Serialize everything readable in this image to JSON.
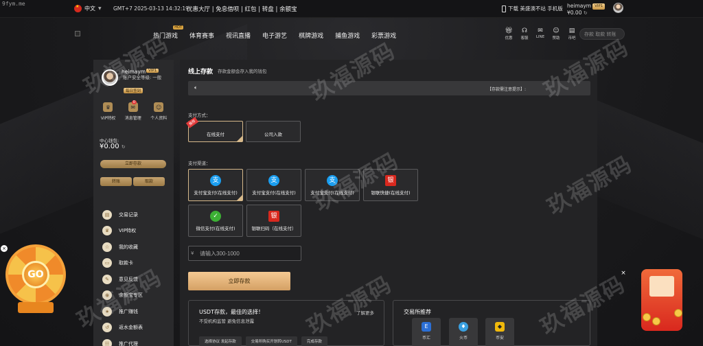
{
  "topbar": {
    "site_tag": "9fym.me",
    "language": "中文",
    "clock": "GMT+7 2025-03-13 14:32:19",
    "quick_links": "优惠大厅 | 免息借呗 | 红包 | 转盘 | 余额宝",
    "download": "下载 美盛澳不站 手机版",
    "username": "heimaym",
    "vip_tag": "VIP1",
    "balance": "¥0.00"
  },
  "nav": {
    "items": [
      {
        "label": "热门游戏",
        "badge": "HOT"
      },
      {
        "label": "体育赛事"
      },
      {
        "label": "视讯直播"
      },
      {
        "label": "电子游艺"
      },
      {
        "label": "棋牌游戏"
      },
      {
        "label": "捕鱼游戏"
      },
      {
        "label": "彩票游戏"
      }
    ],
    "icons": [
      {
        "label": "优惠",
        "icon": "gift-icon"
      },
      {
        "label": "客服",
        "icon": "headset-icon"
      },
      {
        "label": "LINE",
        "icon": "chat-icon"
      },
      {
        "label": "赞助",
        "icon": "people-icon"
      },
      {
        "label": "币吧",
        "icon": "wallet-icon"
      }
    ],
    "search_placeholder": "存款 取款 转账"
  },
  "sidebar": {
    "username": "heimaym",
    "vip": "VIP1",
    "security": "账户安全等级: 一般",
    "sign": "每日签到",
    "quick": [
      {
        "label": "VIP特权",
        "icon": "crown-icon"
      },
      {
        "label": "消息管理",
        "icon": "message-icon",
        "badge": "0"
      },
      {
        "label": "个人资料",
        "icon": "profile-icon"
      }
    ],
    "wallet_label": "中心钱包:",
    "wallet_value": "¥0.00",
    "btn_main": "立即存款",
    "btn_transfer": "转账",
    "btn_withdraw": "取款",
    "menu": [
      {
        "label": "交易记录",
        "icon": "record-icon"
      },
      {
        "label": "VIP特权",
        "icon": "crown-icon"
      },
      {
        "label": "我的收藏",
        "icon": "star-icon"
      },
      {
        "label": "取款卡",
        "icon": "card-icon"
      },
      {
        "label": "意见反馈",
        "icon": "feedback-icon"
      },
      {
        "label": "余额宝专区",
        "icon": "piggy-icon"
      },
      {
        "label": "推广赚钱",
        "icon": "promo-icon"
      },
      {
        "label": "返水金额表",
        "icon": "rebate-icon"
      },
      {
        "label": "推广代理",
        "icon": "agent-icon"
      }
    ]
  },
  "main": {
    "title": "线上存款",
    "subtitle": "存款金额会存入我的钱包",
    "notice": "【存款需注意提示】:",
    "pay_method_label": "支付方式：",
    "pay_methods": [
      {
        "label": "在线支付",
        "ribbon": "推荐",
        "selected": true
      },
      {
        "label": "公司入款",
        "selected": false
      }
    ],
    "channel_label": "支付渠道：",
    "channels": [
      {
        "label": "支付宝支付(在线支付)",
        "icon": "alipay-icon",
        "color": "#1a9ef0",
        "selected": true
      },
      {
        "label": "支付宝支付(在线支付)",
        "icon": "alipay-icon",
        "color": "#1a9ef0",
        "selected": false
      },
      {
        "label": "支付宝支付(在线支付)",
        "icon": "alipay-icon",
        "color": "#1a9ef0",
        "selected": false
      },
      {
        "label": "银联快捷(在线支付)",
        "icon": "unionpay-icon",
        "color": "#d9281e",
        "selected": false
      },
      {
        "label": "微信支付(在线支付)",
        "icon": "wechat-icon",
        "color": "#3cb034",
        "selected": false
      },
      {
        "label": "银联扫码（在线支付）",
        "icon": "unionpay-icon",
        "color": "#d9281e",
        "selected": false
      }
    ],
    "amount_currency": "¥",
    "amount_placeholder": "请输入300-1000",
    "submit": "立即存款",
    "usdt": {
      "title": "USDT存款，最佳的选择！",
      "subtitle": "不受机构监管 避免信息泄露",
      "more": "了解更多",
      "steps": [
        "选择协议 发起存款",
        "交易所购买开划转USDT",
        "完成存款"
      ]
    },
    "exchange": {
      "title": "交易所推荐",
      "items": [
        {
          "label": "币汇",
          "icon": "bihui-icon",
          "color": "#2b6fd6"
        },
        {
          "label": "火币",
          "icon": "huobi-icon",
          "color": "#3aa0e0"
        },
        {
          "label": "币安",
          "icon": "binance-icon",
          "color": "#f0b90b"
        }
      ]
    }
  },
  "watermark": "玖福源码",
  "floating": {
    "wheel_go": "GO",
    "close": "×"
  },
  "colors": {
    "accent": "#d7b98b",
    "gold_button": "#f4c993",
    "background": "#1b1b1d"
  }
}
